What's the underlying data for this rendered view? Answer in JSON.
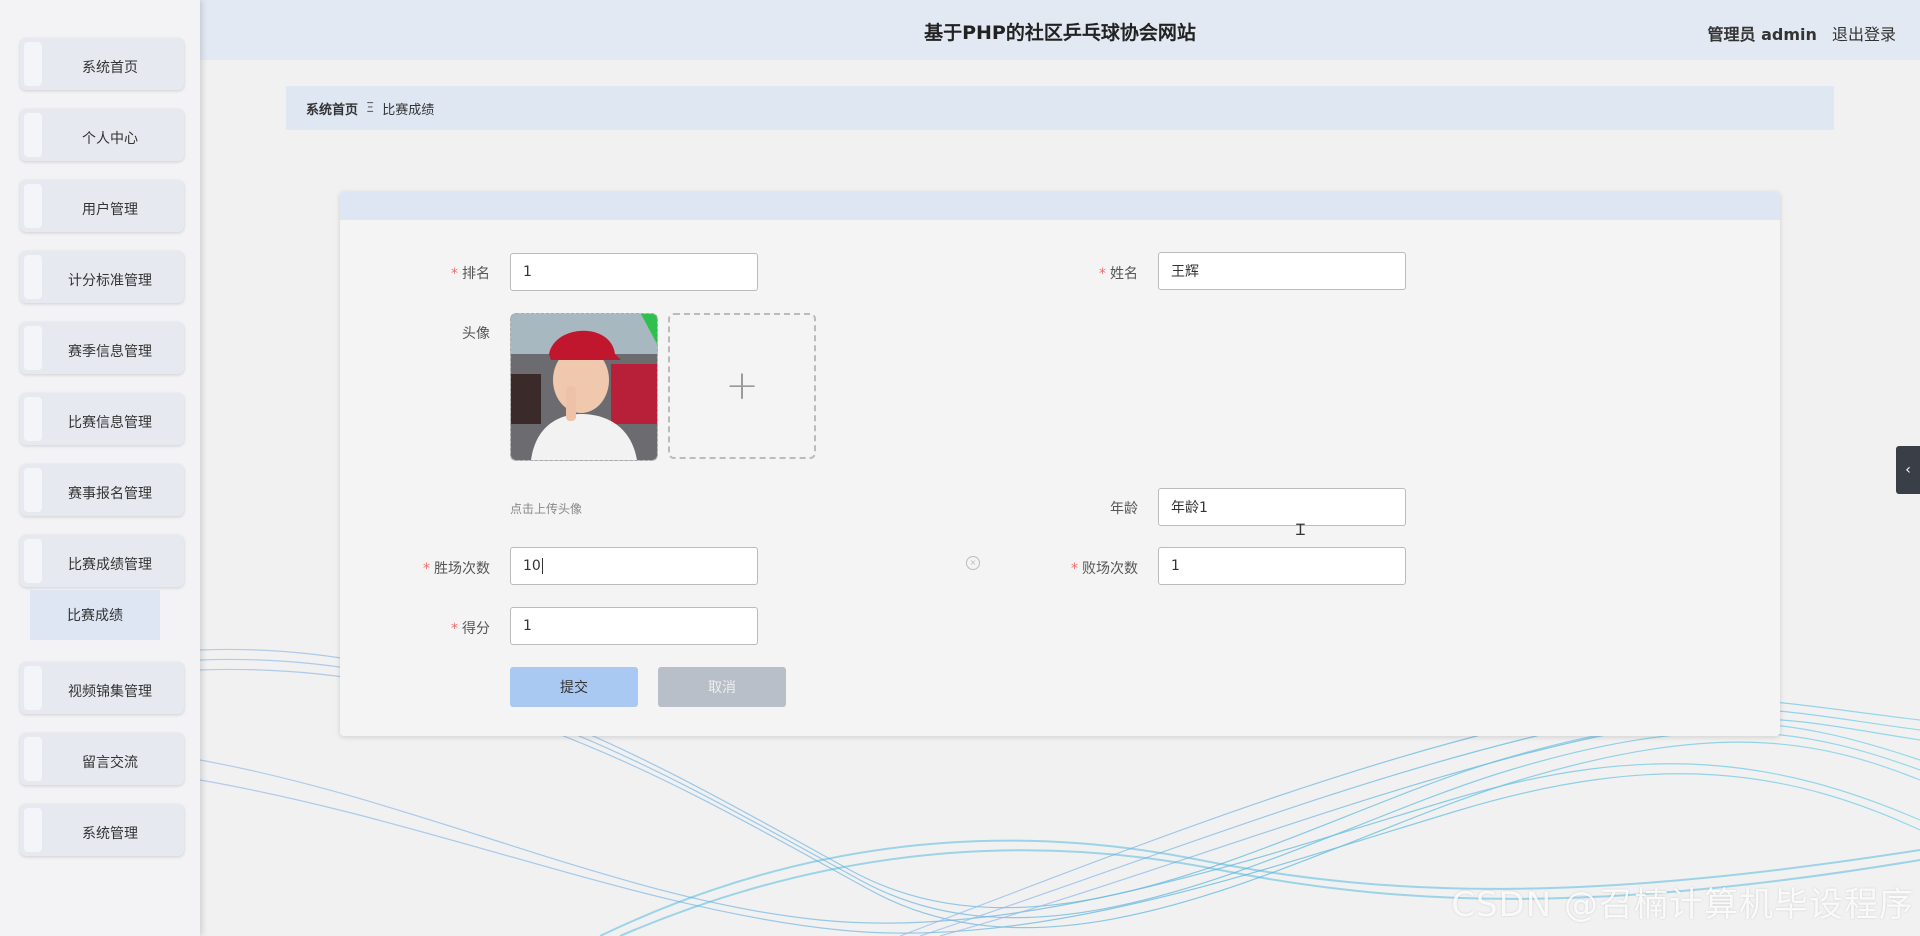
{
  "header": {
    "title": "基于PHP的社区乒乓球协会网站",
    "admin_label": "管理员 admin",
    "logout_label": "退出登录"
  },
  "sidebar": {
    "items": [
      {
        "label": "系统首页"
      },
      {
        "label": "个人中心"
      },
      {
        "label": "用户管理"
      },
      {
        "label": "计分标准管理"
      },
      {
        "label": "赛季信息管理"
      },
      {
        "label": "比赛信息管理"
      },
      {
        "label": "赛事报名管理"
      },
      {
        "label": "比赛成绩管理"
      },
      {
        "label": "视频锦集管理"
      },
      {
        "label": "留言交流"
      },
      {
        "label": "系统管理"
      }
    ],
    "submenu_label": "比赛成绩"
  },
  "breadcrumb": {
    "home": "系统首页",
    "separator": "Ξ",
    "current": "比赛成绩"
  },
  "form": {
    "rank_label": "排名",
    "rank_value": "1",
    "name_label": "姓名",
    "name_value": "王辉",
    "avatar_label": "头像",
    "upload_hint": "点击上传头像",
    "upload_plus": "+",
    "age_label": "年龄",
    "age_value": "年龄1",
    "wins_label": "胜场次数",
    "wins_value": "10",
    "losses_label": "败场次数",
    "losses_value": "1",
    "score_label": "得分",
    "score_value": "1",
    "required_mark": "*",
    "submit_label": "提交",
    "cancel_label": "取消"
  },
  "side_tab_icon": "‹",
  "watermark": "CSDN @召楠计算机毕设程序"
}
